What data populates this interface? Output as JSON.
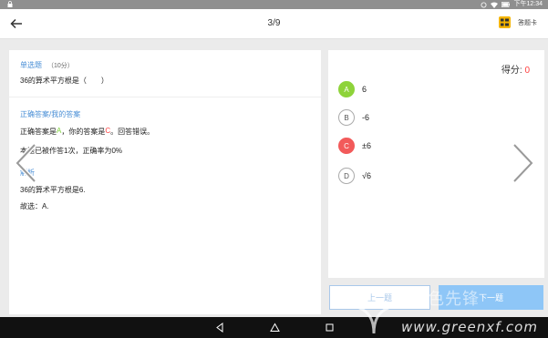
{
  "status": {
    "time": "下午12:34"
  },
  "header": {
    "title": "3/9",
    "answer_card_label": "答题卡"
  },
  "question": {
    "type": "单选题",
    "score": "（10分）",
    "text": "36的算术平方根是（　　）"
  },
  "answer": {
    "heading": "正确答案/我的答案",
    "line_prefix": "正确答案是",
    "correct": "A",
    "line_mid": "，你的答案是",
    "mine": "C",
    "line_suffix": "。回答错误。",
    "stats": "本题已被作答1次，正确率为0%"
  },
  "analysis": {
    "heading": "解析",
    "text": "36的算术平方根是6.",
    "choose": "故选：A."
  },
  "result": {
    "score_label": "得分: ",
    "score_value": "0"
  },
  "options": [
    {
      "letter": "A",
      "text": "6",
      "state": "correct"
    },
    {
      "letter": "B",
      "text": "-6",
      "state": "normal"
    },
    {
      "letter": "C",
      "text": "±6",
      "state": "wrong"
    },
    {
      "letter": "D",
      "text": "√6",
      "state": "normal"
    }
  ],
  "buttons": {
    "prev": "上一题",
    "next": "下一题"
  },
  "watermark": {
    "brand": "绿色先锋",
    "url": "www.greenxf.com"
  },
  "colors": {
    "accent": "#4a8fd6",
    "correct": "#8ed33a",
    "wrong": "#f25a5a"
  }
}
